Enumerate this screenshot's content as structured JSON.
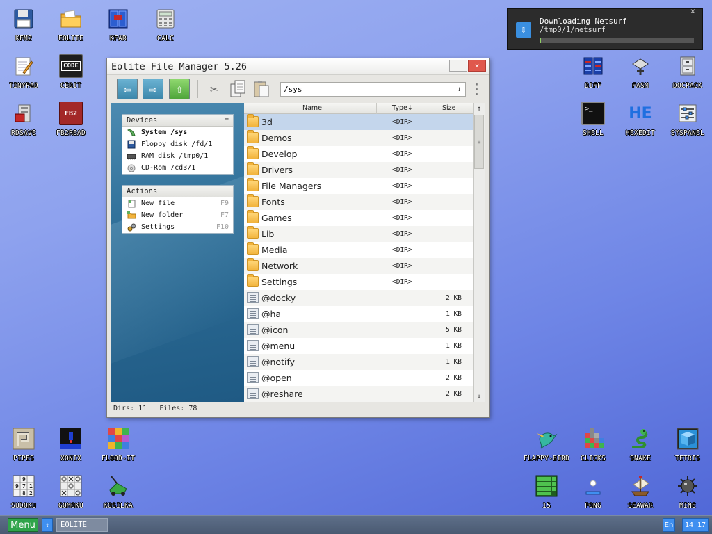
{
  "desktop": {
    "icons": {
      "kfm2": "KFM2",
      "eolite": "EOLITE",
      "kfar": "KFAR",
      "calc": "CALC",
      "tinypad": "TINYPAD",
      "cedit": "CEDIT",
      "rdsave": "RDSAVE",
      "fb2read": "FB2READ",
      "diff": "DIFF",
      "fasm": "FASM",
      "docpack": "DOCPACK",
      "shell": "SHELL",
      "hexedit": "HEXEDIT",
      "syspanel": "SYSPANEL",
      "pipes": "PIPES",
      "xonix": "XONIX",
      "flood_it": "FLOOD-IT",
      "sudoku": "SUDOKU",
      "gomoku": "GOMOKU",
      "kosilka": "KOSILKA",
      "flappy_bird": "FLAPPY-BIRD",
      "clicks": "CLICKS",
      "snake": "SNAKE",
      "tetris": "TETRIS",
      "fifteen": "15",
      "pong": "PONG",
      "seawar": "SEAWAR",
      "mine": "MINE"
    },
    "glyphs": {
      "cedit": "CODE",
      "fb2read": "FB2",
      "shell": ">_",
      "hexedit": "HE"
    }
  },
  "notification": {
    "title": "Downloading Netsurf",
    "path": "/tmp0/1/netsurf",
    "progress": 0.01
  },
  "window": {
    "title": "Eolite File Manager 5.26",
    "minimize": "_",
    "close": "×",
    "path_value": "/sys",
    "devices_header": "Devices",
    "devices": [
      {
        "label": "System /sys"
      },
      {
        "label": "Floppy disk /fd/1"
      },
      {
        "label": "RAM disk /tmp0/1"
      },
      {
        "label": "CD-Rom /cd3/1"
      }
    ],
    "actions_header": "Actions",
    "actions": [
      {
        "label": "New file",
        "key": "F9"
      },
      {
        "label": "New folder",
        "key": "F7"
      },
      {
        "label": "Settings",
        "key": "F10"
      }
    ],
    "columns": {
      "name": "Name",
      "type": "Type↓",
      "size": "Size"
    },
    "files": [
      {
        "name": "3d",
        "type": "<DIR>",
        "size": ""
      },
      {
        "name": "Demos",
        "type": "<DIR>",
        "size": ""
      },
      {
        "name": "Develop",
        "type": "<DIR>",
        "size": ""
      },
      {
        "name": "Drivers",
        "type": "<DIR>",
        "size": ""
      },
      {
        "name": "File Managers",
        "type": "<DIR>",
        "size": ""
      },
      {
        "name": "Fonts",
        "type": "<DIR>",
        "size": ""
      },
      {
        "name": "Games",
        "type": "<DIR>",
        "size": ""
      },
      {
        "name": "Lib",
        "type": "<DIR>",
        "size": ""
      },
      {
        "name": "Media",
        "type": "<DIR>",
        "size": ""
      },
      {
        "name": "Network",
        "type": "<DIR>",
        "size": ""
      },
      {
        "name": "Settings",
        "type": "<DIR>",
        "size": ""
      },
      {
        "name": "@docky",
        "type": "",
        "size": "2 KB"
      },
      {
        "name": "@ha",
        "type": "",
        "size": "1 KB"
      },
      {
        "name": "@icon",
        "type": "",
        "size": "5 KB"
      },
      {
        "name": "@menu",
        "type": "",
        "size": "1 KB"
      },
      {
        "name": "@notify",
        "type": "",
        "size": "1 KB"
      },
      {
        "name": "@open",
        "type": "",
        "size": "2 KB"
      },
      {
        "name": "@reshare",
        "type": "",
        "size": "2 KB"
      }
    ],
    "status": "Dirs: 11   Files: 78"
  },
  "taskbar": {
    "menu": "Menu",
    "task": "EOLITE",
    "lang": "En",
    "clock": "14 17"
  },
  "colors": {
    "selected_row": "#c4d6ec",
    "menu_green": "#2fa44a",
    "accent_blue": "#3f8ff0",
    "close_red": "#e0584d"
  }
}
